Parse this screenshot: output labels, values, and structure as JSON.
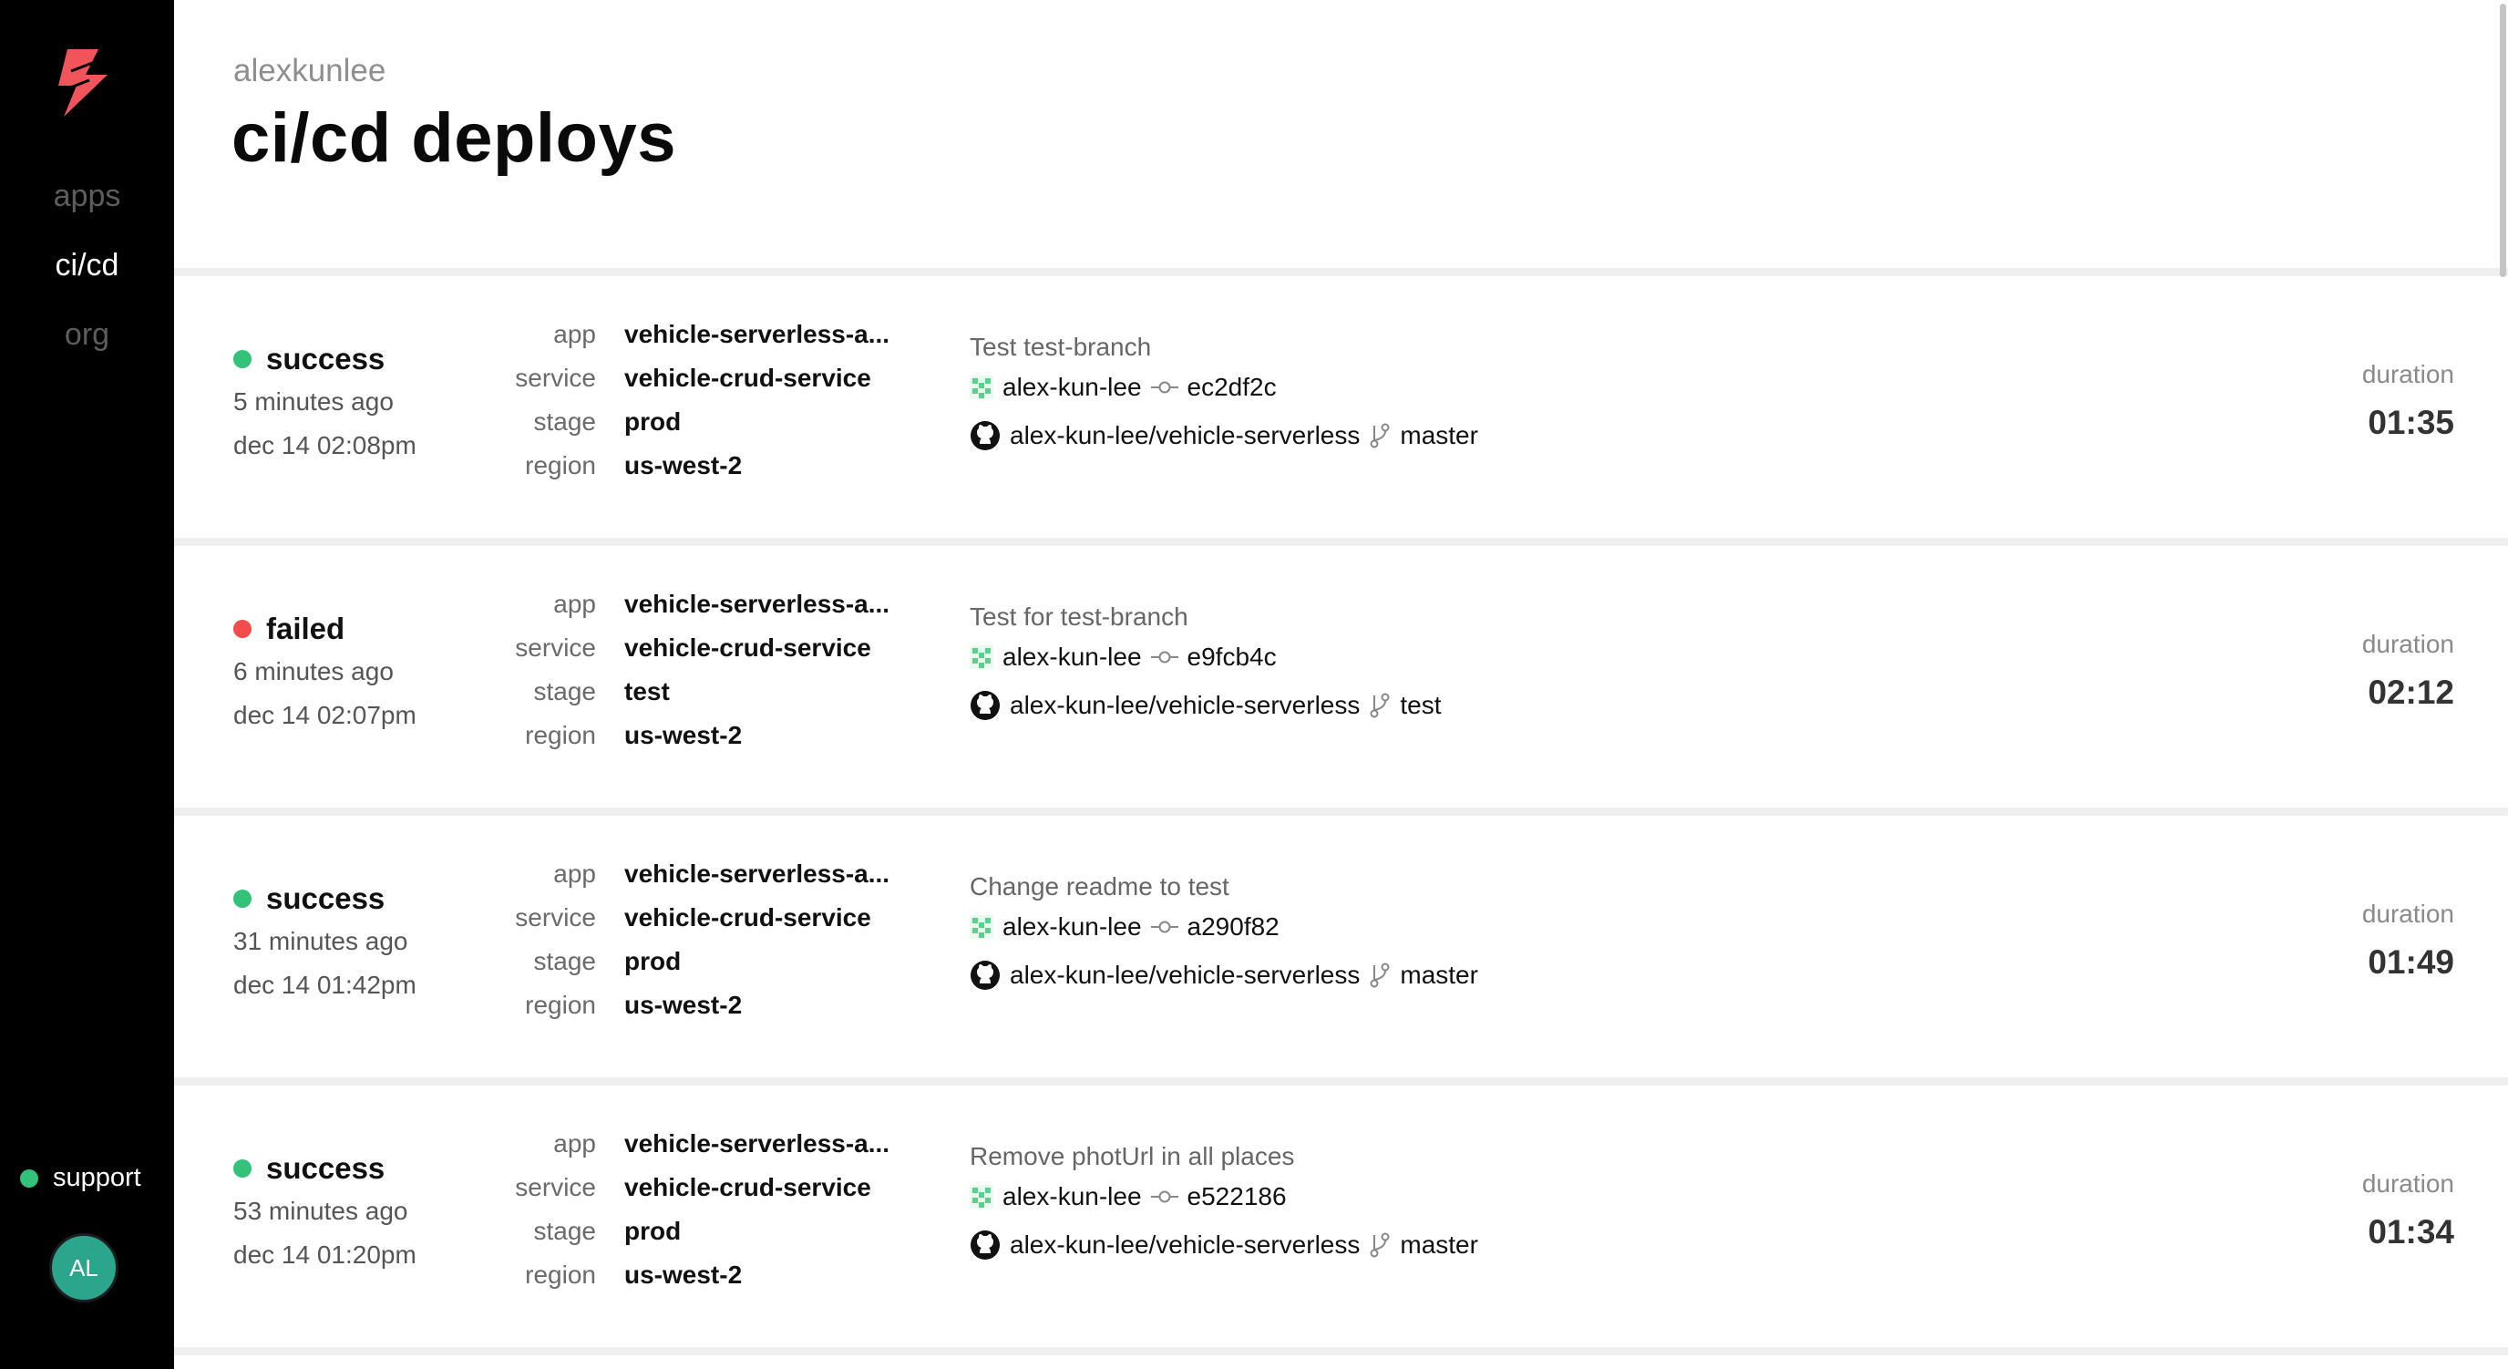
{
  "sidebar": {
    "nav": [
      {
        "label": "apps",
        "active": false
      },
      {
        "label": "ci/cd",
        "active": true
      },
      {
        "label": "org",
        "active": false
      }
    ],
    "support_label": "support",
    "avatar_initials": "AL"
  },
  "header": {
    "org": "alexkunlee",
    "title": "ci/cd deploys"
  },
  "labels": {
    "app": "app",
    "service": "service",
    "stage": "stage",
    "region": "region",
    "duration": "duration"
  },
  "colors": {
    "success": "#32c27a",
    "failed": "#f24c4c",
    "brand": "#f2545b"
  },
  "deploys": [
    {
      "status": "success",
      "ago": "5 minutes ago",
      "when": "dec 14 02:08pm",
      "app": "vehicle-serverless-a...",
      "service": "vehicle-crud-service",
      "stage": "prod",
      "region": "us-west-2",
      "commit_message": "Test test-branch",
      "author": "alex-kun-lee",
      "sha": "ec2df2c",
      "repo": "alex-kun-lee/vehicle-serverless",
      "branch": "master",
      "duration": "01:35"
    },
    {
      "status": "failed",
      "ago": "6 minutes ago",
      "when": "dec 14 02:07pm",
      "app": "vehicle-serverless-a...",
      "service": "vehicle-crud-service",
      "stage": "test",
      "region": "us-west-2",
      "commit_message": "Test for test-branch",
      "author": "alex-kun-lee",
      "sha": "e9fcb4c",
      "repo": "alex-kun-lee/vehicle-serverless",
      "branch": "test",
      "duration": "02:12"
    },
    {
      "status": "success",
      "ago": "31 minutes ago",
      "when": "dec 14 01:42pm",
      "app": "vehicle-serverless-a...",
      "service": "vehicle-crud-service",
      "stage": "prod",
      "region": "us-west-2",
      "commit_message": "Change readme to test",
      "author": "alex-kun-lee",
      "sha": "a290f82",
      "repo": "alex-kun-lee/vehicle-serverless",
      "branch": "master",
      "duration": "01:49"
    },
    {
      "status": "success",
      "ago": "53 minutes ago",
      "when": "dec 14 01:20pm",
      "app": "vehicle-serverless-a...",
      "service": "vehicle-crud-service",
      "stage": "prod",
      "region": "us-west-2",
      "commit_message": "Remove photUrl in all places",
      "author": "alex-kun-lee",
      "sha": "e522186",
      "repo": "alex-kun-lee/vehicle-serverless",
      "branch": "master",
      "duration": "01:34"
    }
  ]
}
